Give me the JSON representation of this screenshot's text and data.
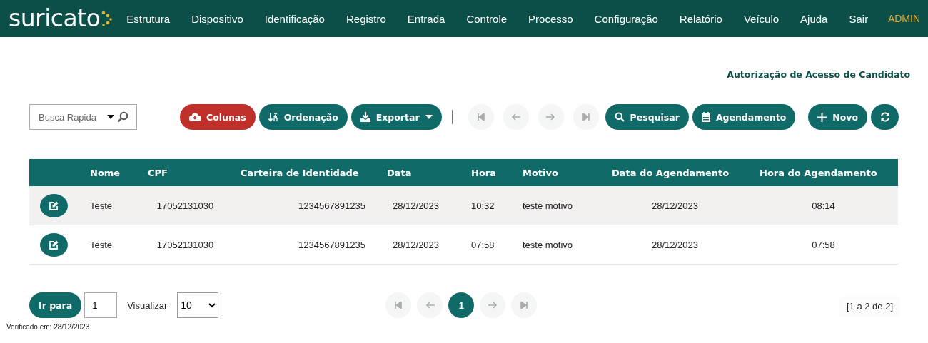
{
  "navbar": {
    "logo": "suricato",
    "menu": [
      "Estrutura",
      "Dispositivo",
      "Identificação",
      "Registro",
      "Entrada",
      "Controle",
      "Processo",
      "Configuração",
      "Relatório",
      "Veículo",
      "Ajuda",
      "Sair"
    ],
    "user": "ADMIN"
  },
  "page_title": "Autorização de Acesso de Candidato",
  "toolbar": {
    "search": {
      "placeholder": "Busca Rapida"
    },
    "buttons": [
      {
        "kind": "columns",
        "label": "Colunas",
        "highlighted": true
      },
      {
        "kind": "sort",
        "label": "Ordenação",
        "highlighted": false
      },
      {
        "kind": "export",
        "label": "Exportar",
        "highlighted": false
      }
    ],
    "nav": [
      {
        "kind": "first",
        "disabled": true
      },
      {
        "kind": "prev",
        "disabled": true
      },
      {
        "kind": "next",
        "disabled": true
      },
      {
        "kind": "last",
        "disabled": true
      }
    ],
    "actions": [
      {
        "kind": "search",
        "label": "Pesquisar"
      },
      {
        "kind": "schedule",
        "label": "Agendamento"
      }
    ],
    "right": [
      {
        "kind": "new",
        "label": "Novo"
      },
      {
        "kind": "refresh"
      }
    ]
  },
  "table": {
    "columns": [
      "Nome",
      "CPF",
      "Carteira de Identidade",
      "Data",
      "Hora",
      "Motivo",
      "Data do Agendamento",
      "Hora do Agendamento"
    ],
    "rows": [
      {
        "cells": [
          "Teste",
          "17052131030",
          "1234567891235",
          "28/12/2023",
          "10:32",
          "teste motivo",
          "28/12/2023",
          "08:14"
        ],
        "selected": true
      },
      {
        "cells": [
          "Teste",
          "17052131030",
          "1234567891235",
          "28/12/2023",
          "07:58",
          "teste motivo",
          "28/12/2023",
          "07:58"
        ],
        "selected": false
      }
    ]
  },
  "footer": {
    "goto_label": "Ir para",
    "goto_value": "1",
    "view_label": "Visualizar",
    "page_size": "10",
    "pager": [
      {
        "kind": "first",
        "disabled": true
      },
      {
        "kind": "prev",
        "disabled": true
      },
      {
        "kind": "page",
        "label": "1",
        "selected": true
      },
      {
        "kind": "next",
        "disabled": true
      },
      {
        "kind": "last",
        "disabled": true
      }
    ],
    "range": "[1 a 2 de 2]"
  },
  "verified": "Verificado em: 28/12/2023"
}
